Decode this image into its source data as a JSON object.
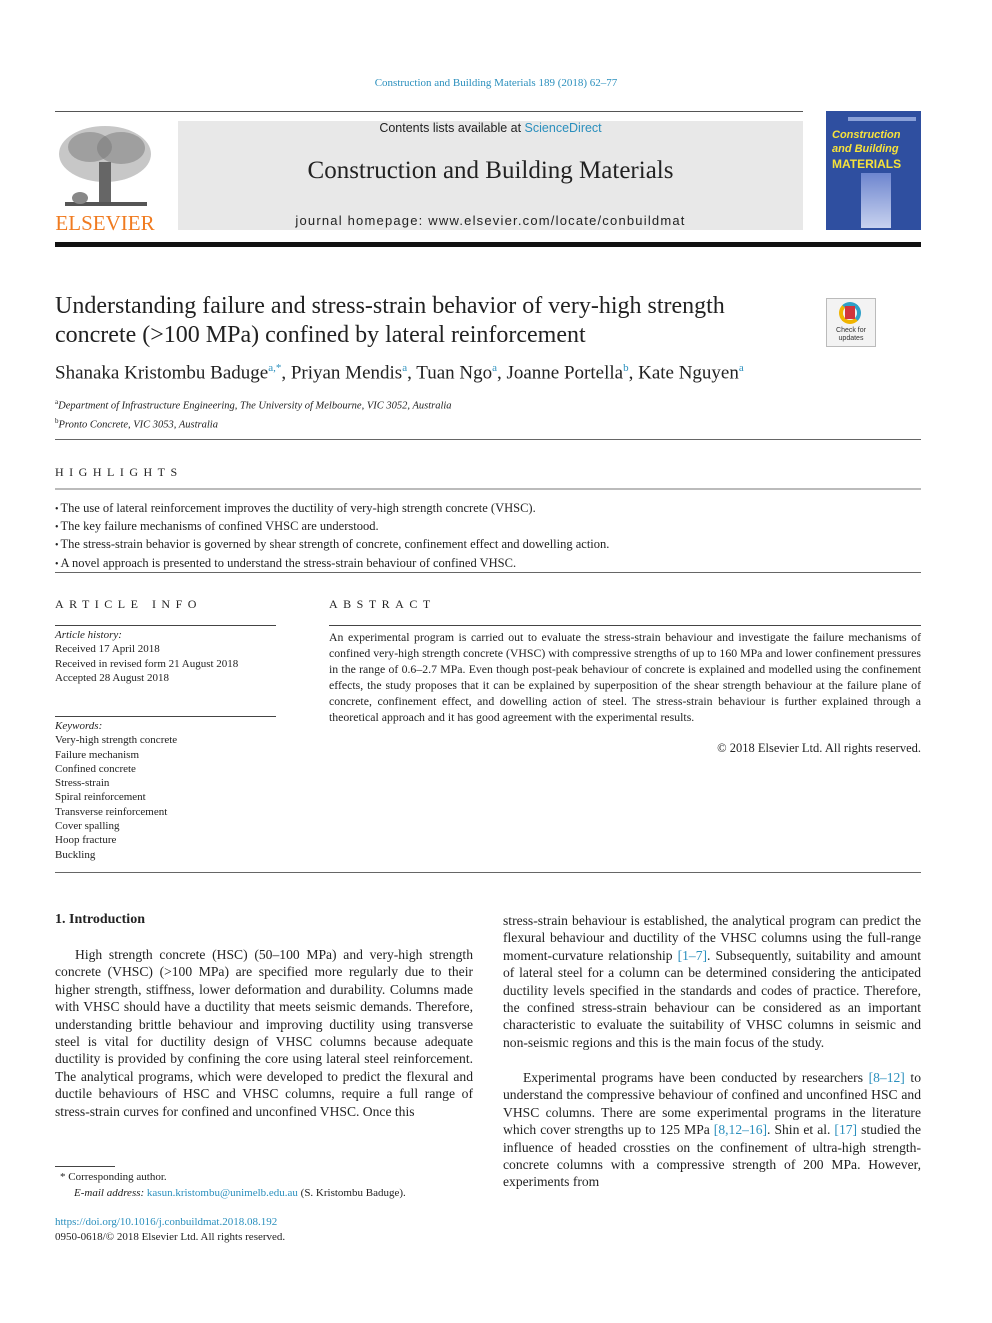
{
  "header": {
    "journal_ref": "Construction and Building Materials 189 (2018) 62–77",
    "contents_prefix": "Contents lists available at ",
    "contents_link": "ScienceDirect",
    "journal_title": "Construction and Building Materials",
    "homepage": "journal homepage: www.elsevier.com/locate/conbuildmat",
    "publisher_logo_text": "ELSEVIER",
    "cover": {
      "line1": "Construction",
      "line2": "and Building",
      "line3": "MATERIALS"
    }
  },
  "article": {
    "title": "Understanding failure and stress-strain behavior of very-high strength concrete (>100 MPa) confined by lateral reinforcement",
    "crossmark_label": "Check for updates",
    "authors": [
      {
        "name": "Shanaka Kristombu Baduge",
        "sup": "a,*"
      },
      {
        "name": "Priyan Mendis",
        "sup": "a"
      },
      {
        "name": "Tuan Ngo",
        "sup": "a"
      },
      {
        "name": "Joanne Portella",
        "sup": "b"
      },
      {
        "name": "Kate Nguyen",
        "sup": "a"
      }
    ],
    "affiliations": [
      {
        "sup": "a",
        "text": "Department of Infrastructure Engineering, The University of Melbourne, VIC 3052, Australia"
      },
      {
        "sup": "b",
        "text": "Pronto Concrete, VIC 3053, Australia"
      }
    ]
  },
  "highlights": {
    "heading": "HIGHLIGHTS",
    "items": [
      "The use of lateral reinforcement improves the ductility of very-high strength concrete (VHSC).",
      "The key failure mechanisms of confined VHSC are understood.",
      "The stress-strain behavior is governed by shear strength of concrete, confinement effect and dowelling action.",
      "A novel approach is presented to understand the stress-strain behaviour of confined VHSC."
    ]
  },
  "article_info": {
    "heading": "ARTICLE INFO",
    "history_label": "Article history:",
    "history": [
      "Received 17 April 2018",
      "Received in revised form 21 August 2018",
      "Accepted 28 August 2018"
    ],
    "keywords_label": "Keywords:",
    "keywords": [
      "Very-high strength concrete",
      "Failure mechanism",
      "Confined concrete",
      "Stress-strain",
      "Spiral reinforcement",
      "Transverse reinforcement",
      "Cover spalling",
      "Hoop fracture",
      "Buckling"
    ]
  },
  "abstract": {
    "heading": "ABSTRACT",
    "text": "An experimental program is carried out to evaluate the stress-strain behaviour and investigate the failure mechanisms of confined very-high strength concrete (VHSC) with compressive strengths of up to 160 MPa and lower confinement pressures in the range of 0.6–2.7 MPa. Even though post-peak behaviour of concrete is explained and modelled using the confinement effects, the study proposes that it can be explained by superposition of the shear strength behaviour at the failure plane of concrete, confinement effect, and dowelling action of steel. The stress-strain behaviour is further explained through a theoretical approach and it has good agreement with the experimental results.",
    "copyright": "© 2018 Elsevier Ltd. All rights reserved."
  },
  "introduction": {
    "heading": "1. Introduction",
    "left": "High strength concrete (HSC) (50–100 MPa) and very-high strength concrete (VHSC) (>100 MPa) are specified more regularly due to their higher strength, stiffness, lower deformation and durability. Columns made with VHSC should have a ductility that meets seismic demands. Therefore, understanding brittle behaviour and improving ductility using transverse steel is vital for ductility design of VHSC columns because adequate ductility is provided by confining the core using lateral steel reinforcement. The analytical programs, which were developed to predict the flexural and ductile behaviours of HSC and VHSC columns, require a full range of stress-strain curves for confined and unconfined VHSC. Once this",
    "right_a_1": "stress-strain behaviour is established, the analytical program can predict the flexural behaviour and ductility of the VHSC columns using the full-range moment-curvature relationship ",
    "ref_1_7": "[1–7]",
    "right_a_2": ". Subsequently, suitability and amount of lateral steel for a column can be determined considering the anticipated ductility levels specified in the standards and codes of practice. Therefore, the confined stress-strain behaviour can be considered as an important characteristic to evaluate the suitability of VHSC columns in seismic and non-seismic regions and this is the main focus of the study.",
    "right_b_1": "Experimental programs have been conducted by researchers ",
    "ref_8_12": "[8–12]",
    "right_b_2": " to understand the compressive behaviour of confined and unconfined HSC and VHSC columns. There are some experimental programs in the literature which cover strengths up to 125 MPa ",
    "ref_8_12_16": "[8,12–16]",
    "right_b_3": ". Shin et al. ",
    "ref_17": "[17]",
    "right_b_4": " studied the influence of headed crossties on the confinement of ultra-high strength-concrete columns with a compressive strength of 200 MPa. However, experiments from"
  },
  "footnotes": {
    "corresponding": "* Corresponding author.",
    "email_label": "E-mail address: ",
    "email": "kasun.kristombu@unimelb.edu.au",
    "email_suffix": " (S. Kristombu Baduge).",
    "doi": "https://doi.org/10.1016/j.conbuildmat.2018.08.192",
    "issn": "0950-0618/© 2018 Elsevier Ltd. All rights reserved."
  }
}
